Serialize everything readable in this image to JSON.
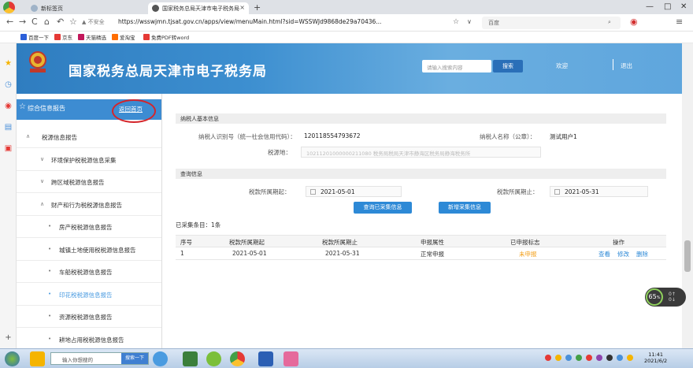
{
  "browser": {
    "tabs": [
      {
        "label": "新标签页",
        "active": false
      },
      {
        "label": "国家税务总局天津市电子税务局",
        "active": true
      }
    ],
    "address": {
      "security": "▲ 不安全",
      "url": "https://wsswjmn.tjsat.gov.cn/apps/view/menuMain.html?sid=WSSWJd9868de29a70436..."
    },
    "search_engine": "百度",
    "bookmarks": [
      "百度一下",
      "京东",
      "天猫精选",
      "爱淘宝",
      "免费PDF转word"
    ]
  },
  "header": {
    "site_title": "国家税务总局天津市电子税务局",
    "search_placeholder": "请输入搜索内容",
    "search_button": "搜索",
    "welcome": "欢迎",
    "logout": "退出"
  },
  "sidebar": {
    "title": "综合信息报告",
    "back_link": "返回首页",
    "items": [
      {
        "label": "税源信息报告",
        "indent": 1,
        "icon": "∧",
        "active": false
      },
      {
        "label": "环境保护税税源信息采集",
        "indent": 2,
        "icon": "∨",
        "active": false
      },
      {
        "label": "跨区域税源信息报告",
        "indent": 2,
        "icon": "∨",
        "active": false
      },
      {
        "label": "财产和行为税税源信息报告",
        "indent": 2,
        "icon": "∧",
        "active": false
      },
      {
        "label": "房产税税源信息报告",
        "indent": 3,
        "icon": "•",
        "active": false
      },
      {
        "label": "城镇土地使用税税源信息报告",
        "indent": 3,
        "icon": "•",
        "active": false
      },
      {
        "label": "车船税税源信息报告",
        "indent": 3,
        "icon": "•",
        "active": false
      },
      {
        "label": "印花税税源信息报告",
        "indent": 3,
        "icon": "•",
        "active": true
      },
      {
        "label": "资源税税源信息报告",
        "indent": 3,
        "icon": "•",
        "active": false
      },
      {
        "label": "耕地占用税税源信息报告",
        "indent": 3,
        "icon": "•",
        "active": false
      }
    ]
  },
  "main": {
    "taxpayer_section": "纳税人基本信息",
    "taxpayer_id_label": "纳税人识别号（统一社会信用代码）：",
    "taxpayer_id": "120118554793672",
    "taxpayer_name_label": "纳税人名称（公章）：",
    "taxpayer_name": "测试用户1",
    "tax_authority_label": "税源地：",
    "tax_authority": "10211201000000211080 税务局税局天津市静海区税务局静海税务所",
    "query_section": "查询信息",
    "period_start_label": "税款所属期起：",
    "period_start": "2021-05-01",
    "period_end_label": "税款所属期止：",
    "period_end": "2021-05-31",
    "query_button": "查询已采集信息",
    "add_button": "新增采集信息",
    "count_text": "已采集条目：1条",
    "table": {
      "headers": [
        "序号",
        "税款所属期起",
        "税款所属期止",
        "申报属性",
        "已申报标志",
        "操作"
      ],
      "rows": [
        {
          "no": "1",
          "start": "2021-05-01",
          "end": "2021-05-31",
          "attr": "正常申报",
          "flag": "未申报",
          "actions": [
            "查看",
            "修改",
            "删除"
          ]
        }
      ]
    }
  },
  "badge": {
    "value": "65",
    "unit": "%",
    "up": "0↑",
    "down": "0↓"
  },
  "taskbar": {
    "search_placeholder": "输入你想搜的",
    "search_button": "搜索一下",
    "time": "11:41",
    "date": "2021/6/2"
  },
  "colors": {
    "accent": "#3d8cd2",
    "banner": "#2f7dc0",
    "warn": "#f39c12",
    "circle": "#d4252b"
  }
}
